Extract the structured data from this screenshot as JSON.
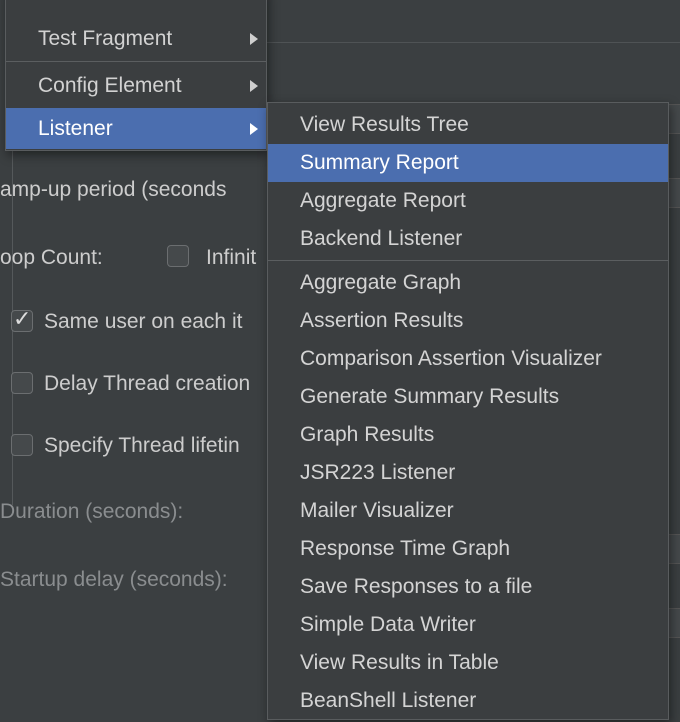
{
  "background_form": {
    "ramp_up_label": "amp-up period (seconds",
    "loop_count_label": "oop Count:",
    "infinite_label": "Infinit",
    "same_user_label": "Same user on each it",
    "delay_thread_label": "Delay Thread creation",
    "specify_lifetime_label": "Specify Thread lifetin",
    "duration_label": "Duration (seconds):",
    "startup_delay_label": "Startup delay (seconds):",
    "same_user_checked": true,
    "infinite_checked": false,
    "delay_thread_checked": false,
    "specify_lifetime_checked": false
  },
  "parent_menu": {
    "items": [
      {
        "label": "Test Fragment",
        "has_submenu": true,
        "selected": false
      },
      {
        "label": "Config Element",
        "has_submenu": true,
        "selected": false
      },
      {
        "label": "Listener",
        "has_submenu": true,
        "selected": true
      }
    ]
  },
  "listener_submenu": {
    "group1": [
      {
        "label": "View Results Tree",
        "selected": false
      },
      {
        "label": "Summary Report",
        "selected": true
      },
      {
        "label": "Aggregate Report",
        "selected": false
      },
      {
        "label": "Backend Listener",
        "selected": false
      }
    ],
    "group2": [
      {
        "label": "Aggregate Graph"
      },
      {
        "label": "Assertion Results"
      },
      {
        "label": "Comparison Assertion Visualizer"
      },
      {
        "label": "Generate Summary Results"
      },
      {
        "label": "Graph Results"
      },
      {
        "label": "JSR223 Listener"
      },
      {
        "label": "Mailer Visualizer"
      },
      {
        "label": "Response Time Graph"
      },
      {
        "label": "Save Responses to a file"
      },
      {
        "label": "Simple Data Writer"
      },
      {
        "label": "View Results in Table"
      },
      {
        "label": "BeanShell Listener"
      }
    ]
  },
  "colors": {
    "background": "#3b3f41",
    "menu_background": "#3b3e40",
    "selection": "#4b6eaf"
  }
}
